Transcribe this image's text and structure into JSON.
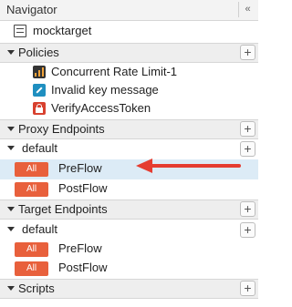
{
  "navigator": {
    "title": "Navigator",
    "collapse_glyph": "«"
  },
  "proxy_name": "mocktarget",
  "sections": {
    "policies": "Policies",
    "proxy_endpoints": "Proxy Endpoints",
    "target_endpoints": "Target Endpoints",
    "scripts": "Scripts"
  },
  "plus_glyph": "+",
  "policies": [
    {
      "label": "Concurrent Rate Limit-1",
      "icon": "bar-chart-icon"
    },
    {
      "label": "Invalid key message",
      "icon": "tag-icon"
    },
    {
      "label": "VerifyAccessToken",
      "icon": "lock-icon"
    }
  ],
  "proxy_endpoints": {
    "group": "default",
    "flows": [
      {
        "badge": "All",
        "label": "PreFlow",
        "selected": true
      },
      {
        "badge": "All",
        "label": "PostFlow",
        "selected": false
      }
    ]
  },
  "target_endpoints": {
    "group": "default",
    "flows": [
      {
        "badge": "All",
        "label": "PreFlow"
      },
      {
        "badge": "All",
        "label": "PostFlow"
      }
    ]
  },
  "colors": {
    "badge": "#e8603c",
    "selection": "#dcebf6",
    "arrow": "#e53c30",
    "section_bg": "#eeeeee"
  }
}
